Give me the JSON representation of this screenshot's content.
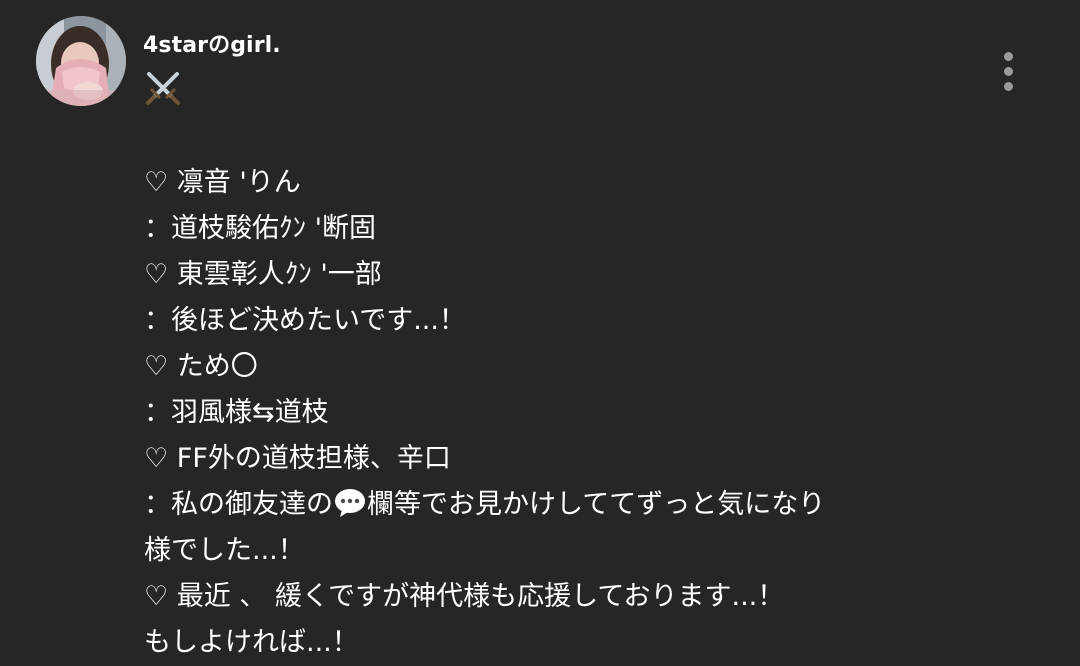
{
  "post": {
    "username": "4starのgirl.",
    "header_emoji": "⚔️",
    "lines": [
      "♡ 凛音 'りん",
      "：道枝駿佑ｸﾝ '断固",
      "♡ 東雲彰人ｸﾝ '一部",
      "：後ほど決めたいです...！",
      "♡ ため〇",
      "：羽風様⇆道枝",
      "♡ FF外の道枝担様、辛口",
      "：私の御友達の",
      "欄等でお見かけしててずっと気になり",
      "様でした...！",
      "♡ 最近 、 緩くですが神代様も応援しております...！",
      "もしよければ...！"
    ],
    "inline_emoji": "💬"
  },
  "icons": {
    "avatar": "profile-photo",
    "header": "crossed-swords-icon",
    "menu": "more-vertical-icon",
    "inline": "speech-bubble-icon"
  },
  "colors": {
    "background": "#262626",
    "text": "#ffffff",
    "menu_dots": "#9a9a9a"
  }
}
